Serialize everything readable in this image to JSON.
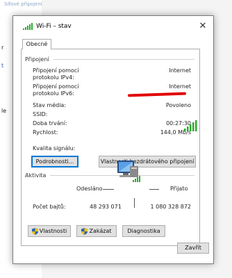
{
  "background": {
    "window_text": "Síťové připojení",
    "fragments": [
      "r",
      "t",
      "le"
    ]
  },
  "dialog": {
    "title": "Wi-Fi – stav",
    "close_glyph": "✕",
    "tab_label": "Obecné",
    "connection": {
      "section_label": "Připojení",
      "ipv4_label_line1": "Připojení pomocí",
      "ipv4_label_line2": "protokolu IPv4:",
      "ipv4_value": "Internet",
      "ipv6_label_line1": "Připojení pomocí",
      "ipv6_label_line2": "protokolu IPv6:",
      "ipv6_value": "Internet",
      "media_state_label": "Stav média:",
      "media_state_value": "Povoleno",
      "ssid_label": "SSID:",
      "duration_label": "Doba trvání:",
      "duration_value": "00:27:30",
      "speed_label": "Rychlost:",
      "speed_value": "144,0 Mb/s",
      "signal_label": "Kvalita signálu:",
      "signal_bars": 5
    },
    "details_button": "Podrobnosti...",
    "wireless_props_button": "Vlastnosti bezdrátového připojení",
    "activity": {
      "section_label": "Aktivita",
      "sent_label": "Odesláno",
      "received_label": "Přijato",
      "bytes_label": "Počet bajtů:",
      "bytes_sent": "48 293 071",
      "bytes_received": "1 080 328 872"
    },
    "properties_button": "Vlastnosti",
    "disable_button": "Zakázat",
    "diagnose_button": "Diagnostika",
    "close_button": "Zavřít"
  },
  "colors": {
    "redaction": "#e10000",
    "signal_green": "#2fa82f",
    "focus_blue": "#0078d7"
  },
  "icons": [
    "wifi-signal-icon",
    "close-icon",
    "network-computer-icon",
    "uac-shield-icon"
  ]
}
